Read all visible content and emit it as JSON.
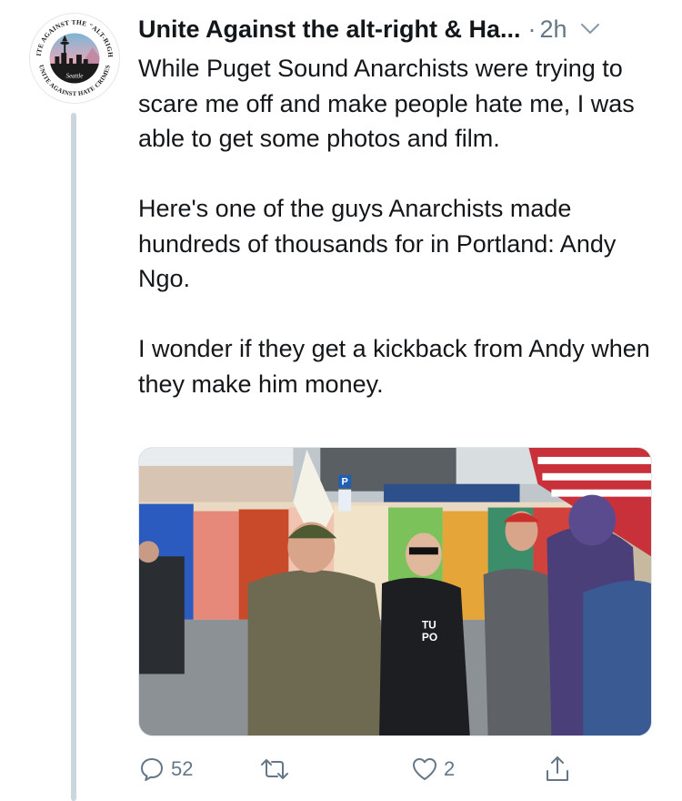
{
  "author": {
    "name": "Unite Against the alt-right & Ha...",
    "avatar_text": {
      "ring_top": "UNITE AGAINST THE \"ALT-RIGHT\"",
      "ring_bottom": "UNITE AGAINST HATE CRIMES",
      "city": "Seattle"
    }
  },
  "meta": {
    "separator": "·",
    "timestamp": "2h"
  },
  "tweet": {
    "paragraphs": [
      "While Puget Sound Anarchists were trying to scare me off and make people hate me, I was able to get some photos and film.",
      "Here's one of the guys Anarchists made hundreds of thousands for in Portland: Andy Ngo.",
      "I wonder if they get a kickback from Andy when they make him money."
    ]
  },
  "media": {
    "sign_text": "P",
    "jacket_text": "TU\nPO"
  },
  "actions": {
    "reply_count": "52",
    "retweet_count": "",
    "like_count": "2"
  },
  "colors": {
    "text": "#14171a",
    "secondary": "#657786",
    "thread_line": "#ccd6dd"
  }
}
